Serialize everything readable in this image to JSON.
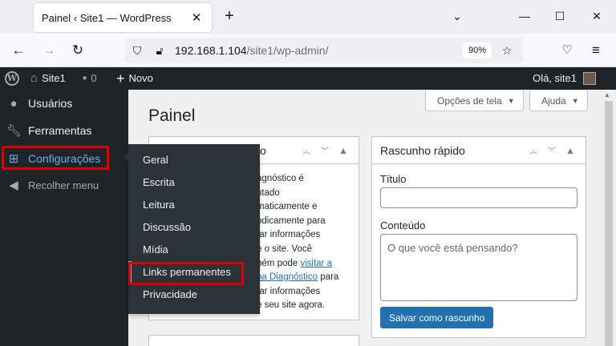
{
  "browser": {
    "tab_title": "Painel ‹ Site1 — WordPress",
    "url_host": "192.168.1.104",
    "url_path": "/site1/wp-admin/",
    "zoom": "90%"
  },
  "adminbar": {
    "site_name": "Site1",
    "comments_count": "0",
    "new_label": "Novo",
    "greeting": "Olá, site1"
  },
  "sidebar": {
    "items": [
      {
        "label": "Usuários",
        "icon": "users-icon"
      },
      {
        "label": "Ferramentas",
        "icon": "wrench-icon"
      },
      {
        "label": "Configurações",
        "icon": "settings-icon"
      },
      {
        "label": "Recolher menu",
        "icon": "collapse-icon"
      }
    ]
  },
  "submenu": {
    "items": [
      "Geral",
      "Escrita",
      "Leitura",
      "Discussão",
      "Mídia",
      "Links permanentes",
      "Privacidade"
    ]
  },
  "main": {
    "page_title": "Painel",
    "screen_options": "Opções de tela",
    "help": "Ajuda",
    "site_health": {
      "title_fragment": "o",
      "lines": [
        "agnóstico é",
        "utado",
        "maticamente e",
        "odicamente para",
        "tar informações",
        "e o site. Você",
        "bém pode ",
        "na Diagnóstico",
        "tar informações",
        "e seu site agora."
      ],
      "link_1": "visitar a",
      "line_8_suffix": " para"
    },
    "quick_draft": {
      "title": "Rascunho rápido",
      "title_label": "Título",
      "title_value": "",
      "content_label": "Conteúdo",
      "content_placeholder": "O que você está pensando?",
      "save_label": "Salvar como rascunho"
    }
  },
  "colors": {
    "accent": "#2271b1",
    "active_menu": "#72aee6",
    "highlight_box": "#e00000",
    "adminbar_bg": "#1d2327"
  }
}
